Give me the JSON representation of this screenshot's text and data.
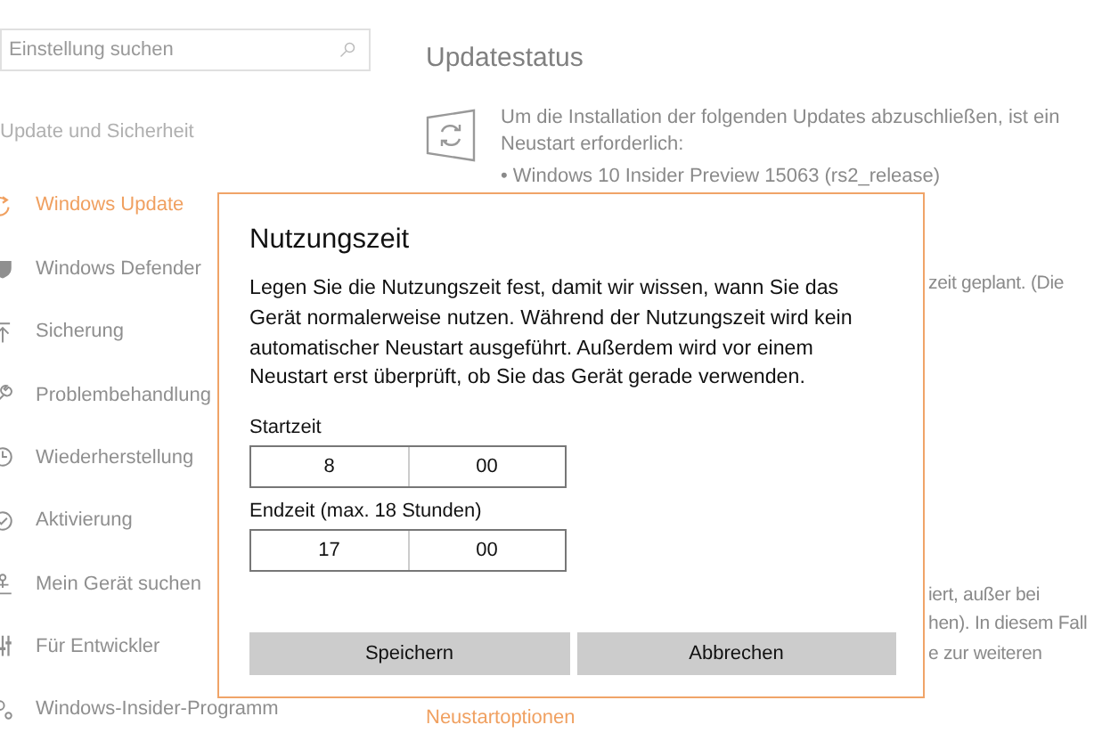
{
  "sidebar": {
    "search": {
      "placeholder": "Einstellung suchen"
    },
    "section": "Update und Sicherheit",
    "items": [
      {
        "label": "Windows Update",
        "selected": true
      },
      {
        "label": "Windows Defender",
        "selected": false
      },
      {
        "label": "Sicherung",
        "selected": false
      },
      {
        "label": "Problembehandlung",
        "selected": false
      },
      {
        "label": "Wiederherstellung",
        "selected": false
      },
      {
        "label": "Aktivierung",
        "selected": false
      },
      {
        "label": "Mein Gerät suchen",
        "selected": false
      },
      {
        "label": "Für Entwickler",
        "selected": false
      },
      {
        "label": "Windows-Insider-Programm",
        "selected": false
      }
    ]
  },
  "main": {
    "status_heading": "Updatestatus",
    "status_message": "Um die Installation der folgenden Updates abzuschließen, ist ein Neustart erforderlich:",
    "update_item": "• Windows 10 Insider Preview 15063 (rs2_release)",
    "fragment_upper": "zeit geplant. (Die",
    "fragments_lower": [
      "iert, außer bei",
      "hen). In diesem Fall",
      "e zur weiteren"
    ],
    "link": "Neustartoptionen"
  },
  "dialog": {
    "title": "Nutzungszeit",
    "message": "Legen Sie die Nutzungszeit fest, damit wir wissen, wann Sie das Gerät normalerweise nutzen. Während der Nutzungszeit wird kein automatischer Neustart ausgeführt. Außerdem wird vor einem Neustart erst überprüft, ob Sie das Gerät gerade verwenden.",
    "fields": [
      {
        "label": "Startzeit",
        "hour": "8",
        "minute": "00"
      },
      {
        "label": "Endzeit (max. 18 Stunden)",
        "hour": "17",
        "minute": "00"
      }
    ],
    "buttons": [
      "Speichern",
      "Abbrechen"
    ]
  }
}
